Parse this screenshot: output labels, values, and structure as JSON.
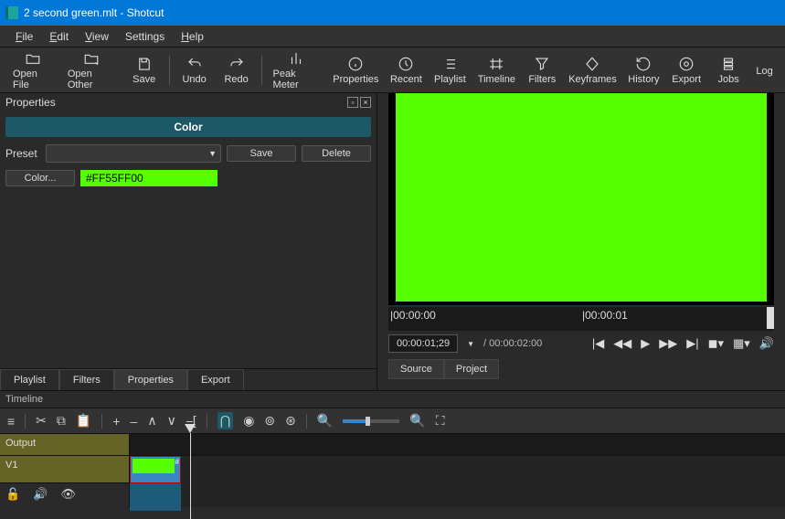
{
  "title": "2 second green.mlt - Shotcut",
  "menu": {
    "file": "File",
    "edit": "Edit",
    "view": "View",
    "settings": "Settings",
    "help": "Help"
  },
  "toolbar": {
    "open": "Open File",
    "openother": "Open Other",
    "save": "Save",
    "undo": "Undo",
    "redo": "Redo",
    "peak": "Peak Meter",
    "props": "Properties",
    "recent": "Recent",
    "playlist": "Playlist",
    "timeline": "Timeline",
    "filters": "Filters",
    "keyframes": "Keyframes",
    "history": "History",
    "export": "Export",
    "jobs": "Jobs",
    "log": "Log"
  },
  "props": {
    "title": "Properties",
    "header": "Color",
    "preset": "Preset",
    "save": "Save",
    "delete": "Delete",
    "colorbtn": "Color...",
    "colorval": "#FF55FF00"
  },
  "tabs": {
    "playlist": "Playlist",
    "filters": "Filters",
    "properties": "Properties",
    "export": "Export"
  },
  "preview": {
    "ticks": [
      "|00:00:00",
      "|00:00:01"
    ],
    "current": "00:00:01;29",
    "duration": "/ 00:00:02:00",
    "source": "Source",
    "project": "Project"
  },
  "timeline": {
    "title": "Timeline",
    "output": "Output",
    "v1": "V1"
  }
}
